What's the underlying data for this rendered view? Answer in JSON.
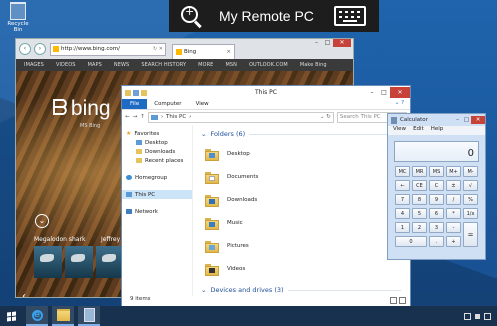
{
  "desktop": {
    "recycle_bin_label": "Recycle Bin"
  },
  "remote_bar": {
    "title": "My Remote PC"
  },
  "browser": {
    "url": "http://www.bing.com/",
    "tab_title": "Bing",
    "nav": [
      "IMAGES",
      "VIDEOS",
      "MAPS",
      "NEWS",
      "SEARCH HISTORY",
      "MORE",
      "MSN",
      "OUTLOOK.COM",
      "Make Bing"
    ],
    "logo": "bing",
    "logo_sub": "MS Bing",
    "captions": [
      "Megalodon shark",
      "Jeffrey D"
    ]
  },
  "explorer": {
    "title": "This PC",
    "ribbon_tabs": {
      "file": "File",
      "computer": "Computer",
      "view": "View"
    },
    "address": "This PC",
    "search_placeholder": "Search This PC",
    "nav": {
      "favorites": "Favorites",
      "desktop": "Desktop",
      "downloads": "Downloads",
      "recent": "Recent places",
      "homegroup": "Homegroup",
      "this_pc": "This PC",
      "network": "Network"
    },
    "folders_header": "Folders (6)",
    "folders": [
      "Desktop",
      "Documents",
      "Downloads",
      "Music",
      "Pictures",
      "Videos"
    ],
    "drives_header": "Devices and drives (3)",
    "status": "9 items"
  },
  "calculator": {
    "title": "Calculator",
    "menu": {
      "view": "View",
      "edit": "Edit",
      "help": "Help"
    },
    "display": "0",
    "keys": [
      "MC",
      "MR",
      "MS",
      "M+",
      "M-",
      "←",
      "CE",
      "C",
      "±",
      "√",
      "7",
      "8",
      "9",
      "/",
      "%",
      "4",
      "5",
      "6",
      "*",
      "1/x",
      "1",
      "2",
      "3",
      "-",
      "=",
      "0",
      ".",
      "+"
    ]
  }
}
